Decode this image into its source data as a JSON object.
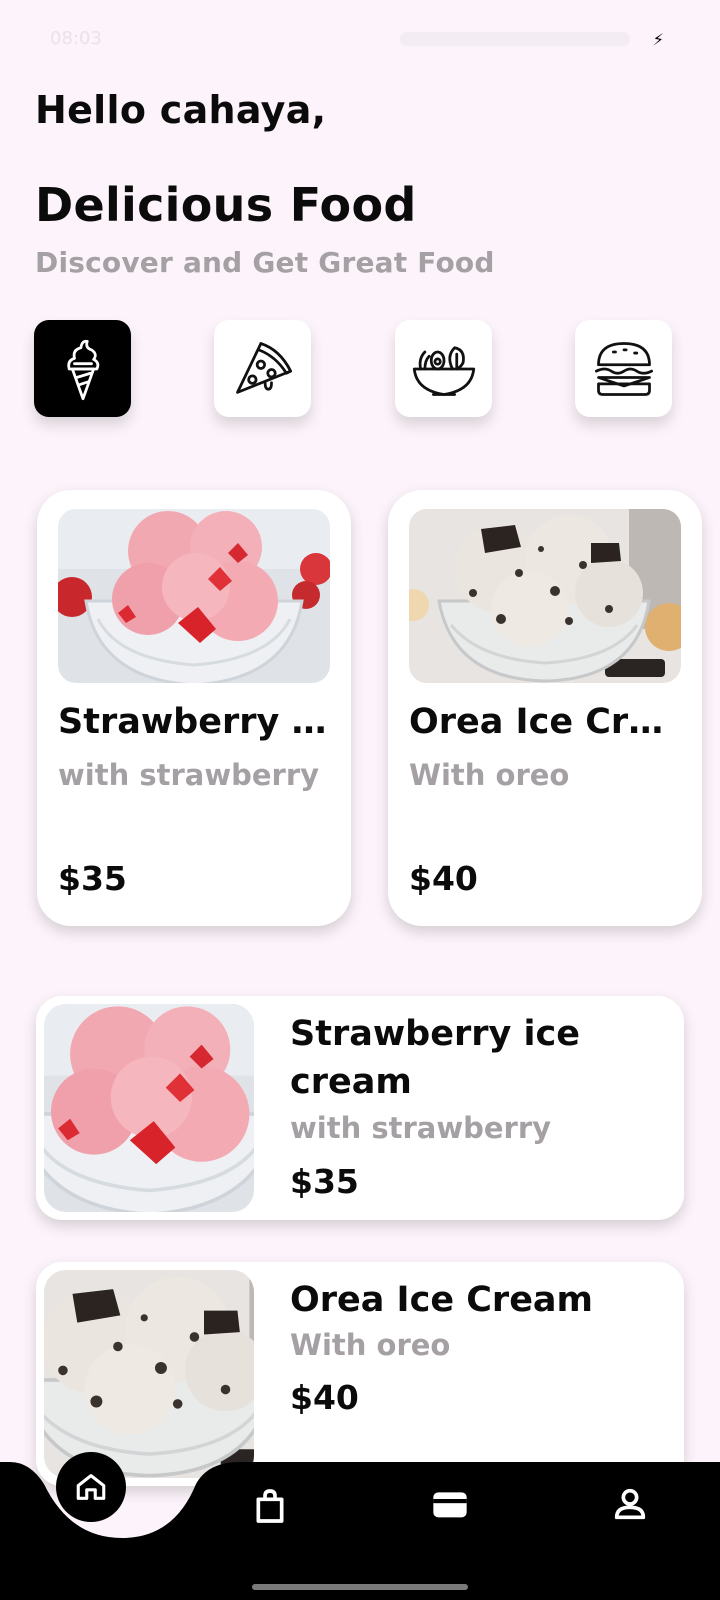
{
  "status_bar": {
    "time": "08:03"
  },
  "header": {
    "greeting": "Hello cahaya,",
    "title": "Delicious Food",
    "subtitle": "Discover and Get Great Food"
  },
  "categories": [
    {
      "icon": "ice-cream-icon",
      "active": true
    },
    {
      "icon": "pizza-icon",
      "active": false
    },
    {
      "icon": "salad-bowl-icon",
      "active": false
    },
    {
      "icon": "burger-icon",
      "active": false
    }
  ],
  "featured": [
    {
      "name": "Strawberry ice cream",
      "description": "with strawberry",
      "price": "$35"
    },
    {
      "name": "Orea Ice Cream",
      "description": "With oreo",
      "price": "$40"
    }
  ],
  "list": [
    {
      "name": "Strawberry ice cream",
      "description": "with strawberry",
      "price": "$35"
    },
    {
      "name": "Orea Ice Cream",
      "description": "With oreo",
      "price": "$40"
    }
  ],
  "bottom_nav": [
    {
      "icon": "home-icon",
      "active": true
    },
    {
      "icon": "shopping-bag-icon",
      "active": false
    },
    {
      "icon": "wallet-icon",
      "active": false
    },
    {
      "icon": "profile-icon",
      "active": false
    }
  ],
  "colors": {
    "background": "#fcf4fa",
    "accent": "#000000",
    "muted_text": "#a4a0a4"
  }
}
